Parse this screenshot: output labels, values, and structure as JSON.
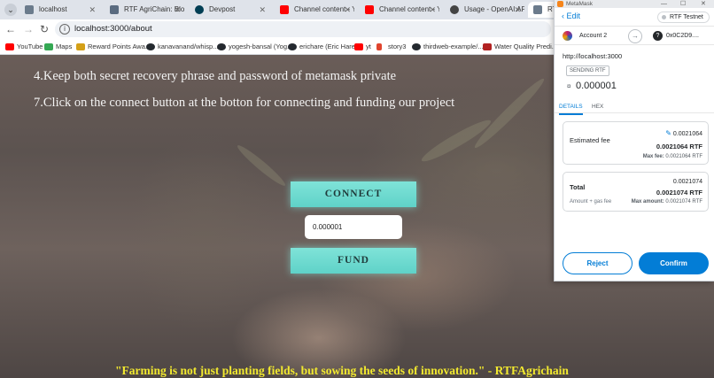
{
  "browser": {
    "tabs": [
      {
        "label": "localhost",
        "color": "#6b7b8c",
        "active": false
      },
      {
        "label": "RTF AgriChain: Block",
        "color": "#5a6b80",
        "active": false
      },
      {
        "label": "Devpost",
        "color": "#003e54",
        "active": false
      },
      {
        "label": "Channel content - Yo",
        "color": "#ff0000",
        "active": false
      },
      {
        "label": "Channel content - Yo",
        "color": "#ff0000",
        "active": false
      },
      {
        "label": "Usage - OpenAI API",
        "color": "#444444",
        "active": false
      },
      {
        "label": "RTFA",
        "color": "#6b7b8c",
        "active": true
      }
    ],
    "url": "localhost:3000/about",
    "bookmarks": [
      {
        "label": "YouTube",
        "color": "#ff0000"
      },
      {
        "label": "Maps",
        "color": "#34a853"
      },
      {
        "label": "Reward Points Awa...",
        "color": "#d4a017"
      },
      {
        "label": "kanavanand/whisp...",
        "color": "#24292f"
      },
      {
        "label": "yogesh-bansal (Yog...",
        "color": "#24292f"
      },
      {
        "label": "erichare (Eric Hare)",
        "color": "#24292f"
      },
      {
        "label": "yt",
        "color": "#ff0000"
      },
      {
        "label": "story3",
        "color": "#e0442e"
      },
      {
        "label": "thirdweb-example/...",
        "color": "#24292f"
      },
      {
        "label": "Water Quality Predi...",
        "color": "#b22222"
      }
    ]
  },
  "page": {
    "step4": "4.Keep both secret recovery phrase and password of metamask private",
    "step7": "7.Click on the connect button at the botton for connecting and funding our project",
    "connect_label": "CONNECT",
    "amount_value": "0.000001",
    "fund_label": "FUND",
    "quote": "\"Farming is not just planting fields, but sowing the seeds of innovation.\" - RTFAgrichain"
  },
  "metamask": {
    "window_title": "MetaMask",
    "edit_label": "Edit",
    "network": "RTF Testnet",
    "from_account": "Account 2",
    "to_account": "0x0C2D9....",
    "origin": "http://localhost:3000",
    "badge": "SENDING RTF",
    "amount": "0.000001",
    "tabs": [
      "DETAILS",
      "HEX"
    ],
    "estimated_fee_label": "Estimated fee",
    "estimated_fee_value": "0.0021064",
    "estimated_fee_rtf": "0.0021064 RTF",
    "max_fee_label": "Max fee:",
    "max_fee_value": "0.0021064 RTF",
    "total_label": "Total",
    "total_value": "0.0021074",
    "total_rtf": "0.0021074 RTF",
    "amount_gas_label": "Amount + gas fee",
    "max_amount_label": "Max amount:",
    "max_amount_value": "0.0021074 RTF",
    "reject_label": "Reject",
    "confirm_label": "Confirm",
    "accent_color": "#037dd6"
  }
}
